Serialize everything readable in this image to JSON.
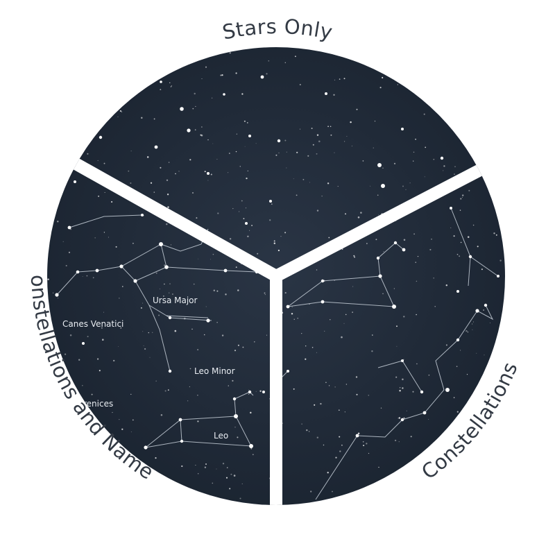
{
  "labels": {
    "top": "Stars Only",
    "right": "Constellations",
    "left": "Constellations and Names"
  },
  "constellation_names": {
    "ursa_major": "Ursa Major",
    "canes_venatici": "Canes Venatici",
    "leo_minor": "Leo Minor",
    "coma_berenices_partial": "renices",
    "leo": "Leo"
  },
  "colors": {
    "sky_dark": "#1b2431",
    "sky_mid": "#2a3545",
    "star": "#ffffff",
    "label": "#333a44",
    "gap": "#ffffff"
  }
}
